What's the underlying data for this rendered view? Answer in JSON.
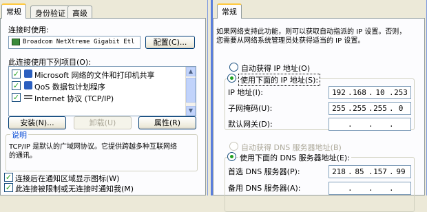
{
  "left": {
    "tabs": [
      "常规",
      "身份验证",
      "高级"
    ],
    "connect_using_label": "连接时使用:",
    "adapter_name": "Broadcom NetXtreme Gigabit Etl",
    "configure_button": "配置(C)...",
    "items_label": "此连接使用下列项目(O):",
    "items": [
      "Microsoft 网络的文件和打印机共享",
      "QoS 数据包计划程序",
      "Internet 协议 (TCP/IP)"
    ],
    "install_button": "安装(N)...",
    "uninstall_button": "卸载(U)",
    "properties_button": "属性(R)",
    "description_legend": "说明",
    "description_text_line1": "TCP/IP 是默认的广域网协议。它提供跨越多种互联网络",
    "description_text_line2": "的通讯。",
    "show_icon_label": "连接后在通知区域显示图标(W)",
    "notify_label": "此连接被限制或无连接时通知我(M)"
  },
  "right": {
    "tab": "常规",
    "intro_line1": "如果网络支持此功能，则可以获取自动指派的 IP 设置。否则，",
    "intro_line2": "您需要从网络系统管理员处获得适当的 IP 设置。",
    "auto_ip_label": "自动获得 IP 地址(O)",
    "manual_ip_label": "使用下面的 IP 地址(S):",
    "ip_label": "IP 地址(I):",
    "ip_value": [
      "192",
      "168",
      "10",
      "253"
    ],
    "mask_label": "子网掩码(U):",
    "mask_value": [
      "255",
      "255",
      "255",
      "0"
    ],
    "gateway_label": "默认网关(D):",
    "auto_dns_label": "自动获得 DNS 服务器地址(B)",
    "manual_dns_label": "使用下面的 DNS 服务器地址(E):",
    "preferred_dns_label": "首选 DNS 服务器(P):",
    "preferred_dns_value": [
      "218",
      "85",
      "157",
      "99"
    ],
    "alternate_dns_label": "备用 DNS 服务器(A):"
  },
  "colors": {
    "dialog_bg": "#ece9d8",
    "tab_body_bg": "#fcfcfe",
    "tab_highlight": "#ffc83c",
    "selection": "#316ac5",
    "check_green": "#21a121",
    "legend_blue": "#0046d5"
  },
  "icons": [
    "network-adapter-icon",
    "network-component-icon",
    "protocol-icon"
  ]
}
